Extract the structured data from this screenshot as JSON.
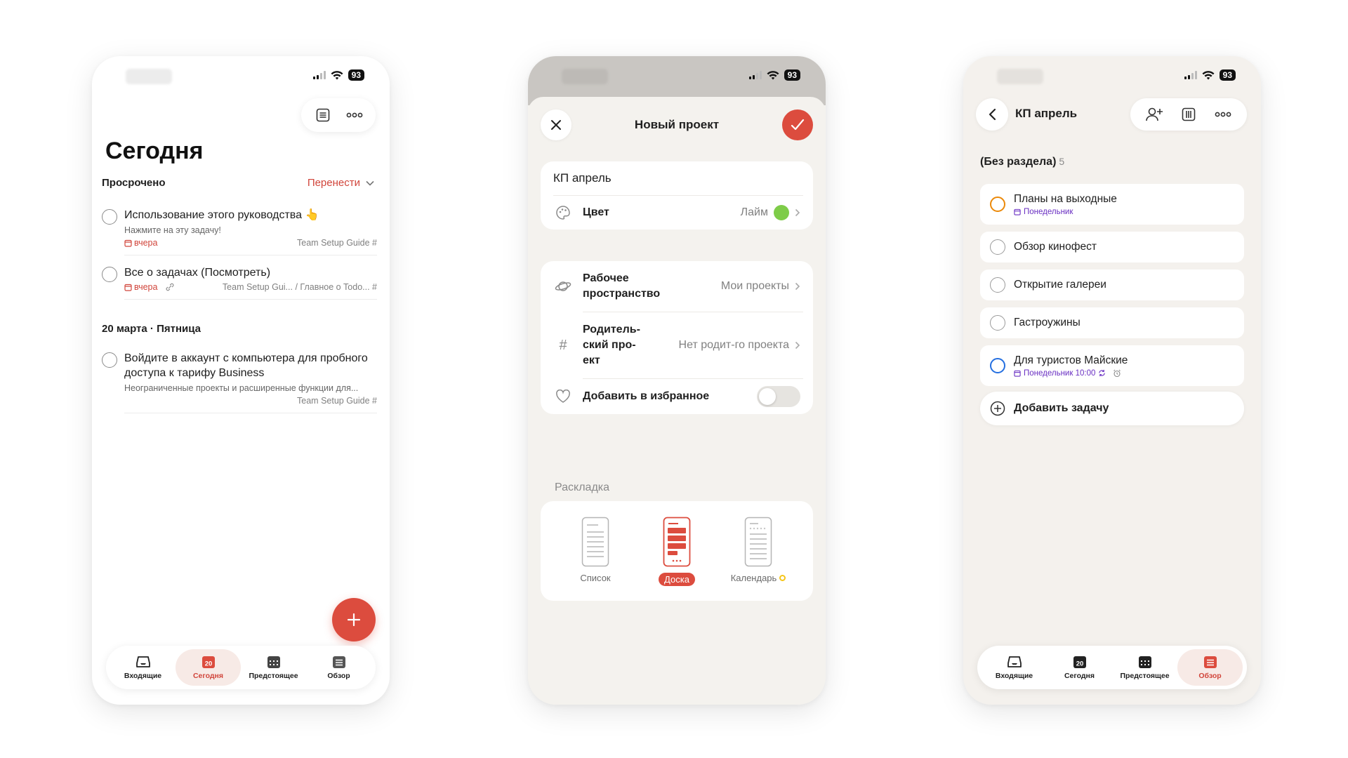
{
  "status": {
    "battery": "93"
  },
  "phone1": {
    "title": "Сегодня",
    "overdue": {
      "title": "Просрочено",
      "action": "Перенести",
      "tasks": [
        {
          "title": "Использование этого руководства 👆",
          "desc": "Нажмите на эту задачу!",
          "date": "вчера",
          "project": "Team Setup Guide #"
        },
        {
          "title": "Все о задачах (Посмотреть)",
          "date": "вчера",
          "project": "Team Setup Gui... / Главное о Todo... #"
        }
      ]
    },
    "day": {
      "title": "20 марта · Пятница",
      "tasks": [
        {
          "title": "Войдите в аккаунт с компьютера для пробного доступа к тарифу Business",
          "desc": "Неограниченные проекты и расширенные функции для...",
          "project": "Team Setup Guide #"
        }
      ]
    },
    "fab": "+",
    "tabs": [
      {
        "label": "Входящие"
      },
      {
        "label": "Сегодня",
        "badge": "20"
      },
      {
        "label": "Предстоящее"
      },
      {
        "label": "Обзор"
      }
    ]
  },
  "phone2": {
    "title": "Новый проект",
    "name_value": "КП апрель",
    "color_label": "Цвет",
    "color_value": "Лайм",
    "color_hex": "#7ecc49",
    "workspace_label": "Рабочее пространство",
    "workspace_value": "Мои проекты",
    "parent_label": "Родитель-ский про-ект",
    "parent_value": "Нет родит-го проекта",
    "favorite_label": "Добавить в избранное",
    "favorite_on": false,
    "layout_title": "Раскладка",
    "layouts": [
      {
        "label": "Список"
      },
      {
        "label": "Доска",
        "selected": true
      },
      {
        "label": "Календарь"
      }
    ]
  },
  "phone3": {
    "title": "КП апрель",
    "section": "(Без раздела)",
    "section_count": "5",
    "tasks": [
      {
        "title": "Планы на выходные",
        "date": "Понедельник",
        "ring": "#eb8909"
      },
      {
        "title": "Обзор кинофест"
      },
      {
        "title": "Открытие галереи"
      },
      {
        "title": "Гастроужины"
      },
      {
        "title": "Для туристов Майские",
        "date": "Понедельник 10:00",
        "ring": "#246fe0"
      }
    ],
    "add_task": "Добавить задачу",
    "tabs": [
      {
        "label": "Входящие"
      },
      {
        "label": "Сегодня",
        "badge": "20"
      },
      {
        "label": "Предстоящее"
      },
      {
        "label": "Обзор"
      }
    ]
  },
  "colors": {
    "accent": "#dc4c3e",
    "accent_text": "#d1453b",
    "purple_date": "#692fc2"
  }
}
